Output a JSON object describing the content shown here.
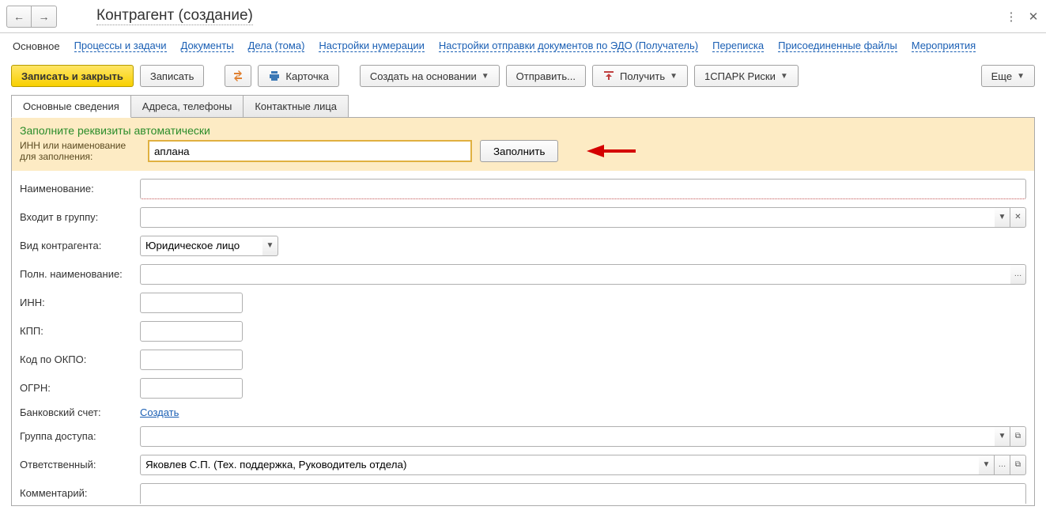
{
  "header": {
    "title": "Контрагент (создание)"
  },
  "navTabs": [
    {
      "label": "Основное",
      "active": true
    },
    {
      "label": "Процессы и задачи"
    },
    {
      "label": "Документы"
    },
    {
      "label": "Дела (тома)"
    },
    {
      "label": "Настройки нумерации"
    },
    {
      "label": "Настройки отправки документов по ЭДО (Получатель)"
    },
    {
      "label": "Переписка"
    },
    {
      "label": "Присоединенные файлы"
    },
    {
      "label": "Мероприятия"
    }
  ],
  "toolbar": {
    "saveClose": "Записать и закрыть",
    "save": "Записать",
    "card": "Карточка",
    "createBased": "Создать на основании",
    "send": "Отправить...",
    "receive": "Получить",
    "spark": "1СПАРК Риски",
    "more": "Еще"
  },
  "innerTabs": [
    {
      "label": "Основные сведения",
      "active": true
    },
    {
      "label": "Адреса, телефоны"
    },
    {
      "label": "Контактные лица"
    }
  ],
  "banner": {
    "title": "Заполните реквизиты автоматически",
    "label": "ИНН или наименование для заполнения:",
    "value": "аплана",
    "button": "Заполнить"
  },
  "form": {
    "nameLabel": "Наименование:",
    "nameValue": "",
    "groupLabel": "Входит в группу:",
    "groupValue": "",
    "kindLabel": "Вид контрагента:",
    "kindValue": "Юридическое лицо",
    "fullNameLabel": "Полн. наименование:",
    "fullNameValue": "",
    "innLabel": "ИНН:",
    "innValue": "",
    "kppLabel": "КПП:",
    "kppValue": "",
    "okpoLabel": "Код по ОКПО:",
    "okpoValue": "",
    "ogrnLabel": "ОГРН:",
    "ogrnValue": "",
    "bankLabel": "Банковский счет:",
    "bankLink": "Создать",
    "accessLabel": "Группа доступа:",
    "accessValue": "",
    "respLabel": "Ответственный:",
    "respValue": "Яковлев С.П. (Тех. поддержка, Руководитель отдела)",
    "commentLabel": "Комментарий:",
    "commentValue": ""
  }
}
